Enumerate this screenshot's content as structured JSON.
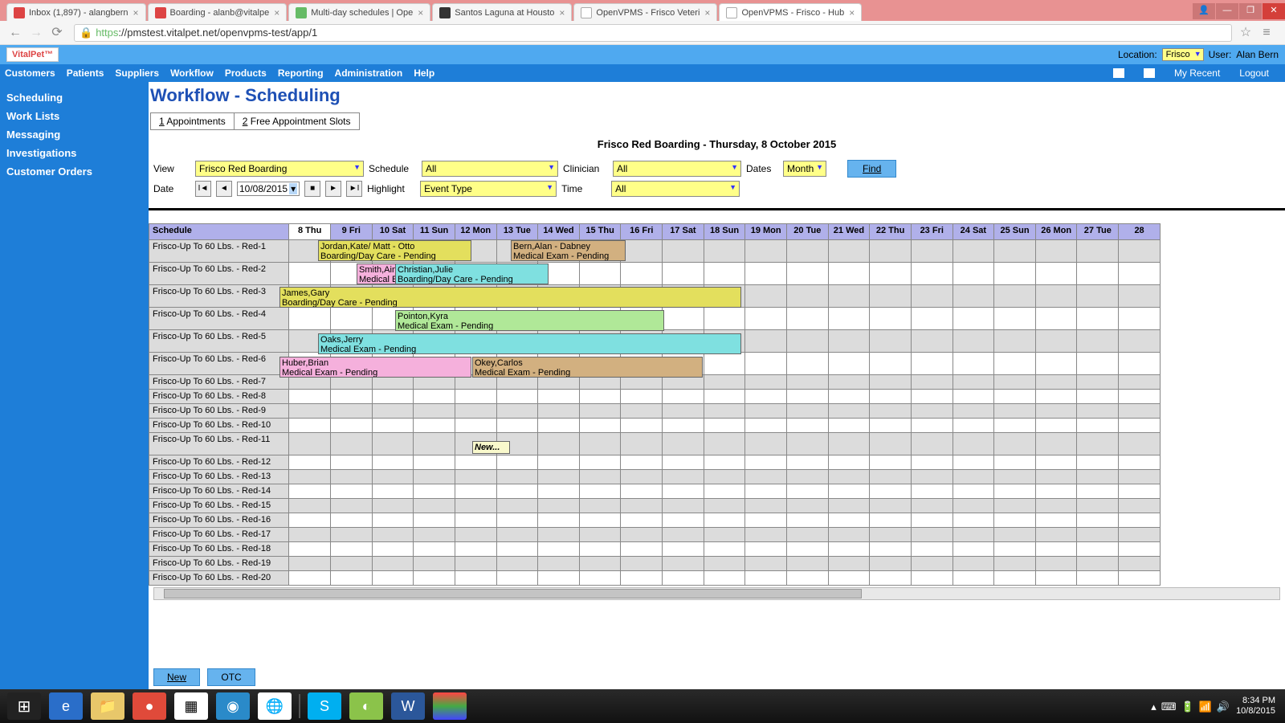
{
  "browser": {
    "tabs": [
      {
        "label": "Inbox (1,897) - alangbern",
        "icon": "gmail"
      },
      {
        "label": "Boarding - alanb@vitalpe",
        "icon": "gmail"
      },
      {
        "label": "Multi-day schedules | Ope",
        "icon": "green"
      },
      {
        "label": "Santos Laguna at Housto",
        "icon": "dark"
      },
      {
        "label": "OpenVPMS - Frisco Veteri",
        "icon": "page"
      },
      {
        "label": "OpenVPMS - Frisco - Hub",
        "icon": "page",
        "active": true
      }
    ],
    "url_proto": "https",
    "url_rest": "://pmstest.vitalpet.net/openvpms-test/app/1"
  },
  "app": {
    "logo": "VitalPet™",
    "location_label": "Location:",
    "location_value": "Frisco",
    "user_label": "User:",
    "user_value": "Alan Bern"
  },
  "menu": {
    "items": [
      "Customers",
      "Patients",
      "Suppliers",
      "Workflow",
      "Products",
      "Reporting",
      "Administration",
      "Help"
    ],
    "right": [
      "My Recent",
      "Logout"
    ]
  },
  "sidebar": {
    "items": [
      "Scheduling",
      "Work Lists",
      "Messaging",
      "Investigations",
      "Customer Orders"
    ]
  },
  "page": {
    "title": "Workflow - Scheduling",
    "subtabs": [
      {
        "key": "1",
        "label": "Appointments"
      },
      {
        "key": "2",
        "label": "Free Appointment Slots"
      }
    ],
    "schedule_header": "Frisco Red Boarding - Thursday, 8 October 2015"
  },
  "filters": {
    "view_label": "View",
    "view_value": "Frisco Red Boarding",
    "schedule_label": "Schedule",
    "schedule_value": "All",
    "clinician_label": "Clinician",
    "clinician_value": "All",
    "dates_label": "Dates",
    "dates_value": "Month",
    "date_label": "Date",
    "date_value": "10/08/2015",
    "highlight_label": "Highlight",
    "highlight_value": "Event Type",
    "time_label": "Time",
    "time_value": "All",
    "find": "Find"
  },
  "grid": {
    "schedule_col": "Schedule",
    "days": [
      "8 Thu",
      "9 Fri",
      "10 Sat",
      "11 Sun",
      "12 Mon",
      "13 Tue",
      "14 Wed",
      "15 Thu",
      "16 Fri",
      "17 Sat",
      "18 Sun",
      "19 Mon",
      "20 Tue",
      "21 Wed",
      "22 Thu",
      "23 Fri",
      "24 Sat",
      "25 Sun",
      "26 Mon",
      "27 Tue",
      "28"
    ],
    "rows": [
      "Frisco-Up To 60 Lbs. - Red-1",
      "Frisco-Up To 60 Lbs. - Red-2",
      "Frisco-Up To 60 Lbs. - Red-3",
      "Frisco-Up To 60 Lbs. - Red-4",
      "Frisco-Up To 60 Lbs. - Red-5",
      "Frisco-Up To 60 Lbs. - Red-6",
      "Frisco-Up To 60 Lbs. - Red-7",
      "Frisco-Up To 60 Lbs. - Red-8",
      "Frisco-Up To 60 Lbs. - Red-9",
      "Frisco-Up To 60 Lbs. - Red-10",
      "Frisco-Up To 60 Lbs. - Red-11",
      "Frisco-Up To 60 Lbs. - Red-12",
      "Frisco-Up To 60 Lbs. - Red-13",
      "Frisco-Up To 60 Lbs. - Red-14",
      "Frisco-Up To 60 Lbs. - Red-15",
      "Frisco-Up To 60 Lbs. - Red-16",
      "Frisco-Up To 60 Lbs. - Red-17",
      "Frisco-Up To 60 Lbs. - Red-18",
      "Frisco-Up To 60 Lbs. - Red-19",
      "Frisco-Up To 60 Lbs. - Red-20"
    ]
  },
  "appointments": [
    {
      "row": 0,
      "start": 1,
      "span": 4,
      "color": "c-yellow",
      "line1": "Jordan,Kate/ Matt - Otto",
      "line2": "Boarding/Day Care - Pending",
      "info": true
    },
    {
      "row": 0,
      "start": 6,
      "span": 3,
      "color": "c-tan",
      "line1": "Bern,Alan - Dabney",
      "line2": "Medical Exam - Pending"
    },
    {
      "row": 1,
      "start": 2,
      "span": 3,
      "color": "c-pink",
      "line1": "Smith,Aine",
      "line2": "Medical Exam - Pending"
    },
    {
      "row": 1,
      "start": 3,
      "span": 4,
      "color": "c-cyan",
      "line1": "Christian,Julie",
      "line2": "Boarding/Day Care - Pending",
      "z": 1
    },
    {
      "row": 2,
      "start": 0,
      "span": 12,
      "color": "c-yellow",
      "line1": "James,Gary",
      "line2": "Boarding/Day Care - Pending"
    },
    {
      "row": 3,
      "start": 3,
      "span": 7,
      "color": "c-green",
      "line1": "Pointon,Kyra",
      "line2": "Medical Exam - Pending"
    },
    {
      "row": 4,
      "start": 1,
      "span": 11,
      "color": "c-cyan",
      "line1": "Oaks,Jerry",
      "line2": "Medical Exam - Pending"
    },
    {
      "row": 5,
      "start": 0,
      "span": 5,
      "color": "c-pink",
      "line1": "Huber,Brian",
      "line2": "Medical Exam - Pending"
    },
    {
      "row": 5,
      "start": 5,
      "span": 6,
      "color": "c-tan",
      "line1": "Okey,Carlos",
      "line2": "Medical Exam - Pending"
    },
    {
      "row": 10,
      "start": 5,
      "span": 1,
      "color": "c-new",
      "line1": "New...",
      "line2": ""
    }
  ],
  "buttons": {
    "new": "New",
    "otc": "OTC"
  },
  "taskbar": {
    "time": "8:34 PM",
    "date": "10/8/2015"
  }
}
